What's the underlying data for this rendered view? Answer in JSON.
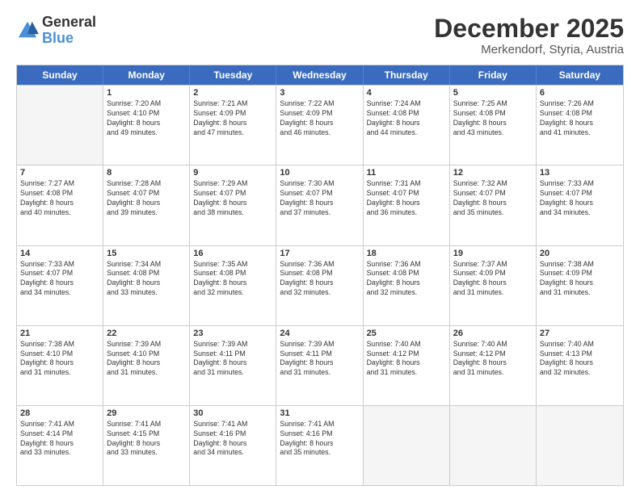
{
  "header": {
    "logo_general": "General",
    "logo_blue": "Blue",
    "month_title": "December 2025",
    "subtitle": "Merkendorf, Styria, Austria"
  },
  "calendar": {
    "days": [
      "Sunday",
      "Monday",
      "Tuesday",
      "Wednesday",
      "Thursday",
      "Friday",
      "Saturday"
    ],
    "rows": [
      [
        {
          "day": "",
          "text": ""
        },
        {
          "day": "1",
          "text": "Sunrise: 7:20 AM\nSunset: 4:10 PM\nDaylight: 8 hours\nand 49 minutes."
        },
        {
          "day": "2",
          "text": "Sunrise: 7:21 AM\nSunset: 4:09 PM\nDaylight: 8 hours\nand 47 minutes."
        },
        {
          "day": "3",
          "text": "Sunrise: 7:22 AM\nSunset: 4:09 PM\nDaylight: 8 hours\nand 46 minutes."
        },
        {
          "day": "4",
          "text": "Sunrise: 7:24 AM\nSunset: 4:08 PM\nDaylight: 8 hours\nand 44 minutes."
        },
        {
          "day": "5",
          "text": "Sunrise: 7:25 AM\nSunset: 4:08 PM\nDaylight: 8 hours\nand 43 minutes."
        },
        {
          "day": "6",
          "text": "Sunrise: 7:26 AM\nSunset: 4:08 PM\nDaylight: 8 hours\nand 41 minutes."
        }
      ],
      [
        {
          "day": "7",
          "text": "Sunrise: 7:27 AM\nSunset: 4:08 PM\nDaylight: 8 hours\nand 40 minutes."
        },
        {
          "day": "8",
          "text": "Sunrise: 7:28 AM\nSunset: 4:07 PM\nDaylight: 8 hours\nand 39 minutes."
        },
        {
          "day": "9",
          "text": "Sunrise: 7:29 AM\nSunset: 4:07 PM\nDaylight: 8 hours\nand 38 minutes."
        },
        {
          "day": "10",
          "text": "Sunrise: 7:30 AM\nSunset: 4:07 PM\nDaylight: 8 hours\nand 37 minutes."
        },
        {
          "day": "11",
          "text": "Sunrise: 7:31 AM\nSunset: 4:07 PM\nDaylight: 8 hours\nand 36 minutes."
        },
        {
          "day": "12",
          "text": "Sunrise: 7:32 AM\nSunset: 4:07 PM\nDaylight: 8 hours\nand 35 minutes."
        },
        {
          "day": "13",
          "text": "Sunrise: 7:33 AM\nSunset: 4:07 PM\nDaylight: 8 hours\nand 34 minutes."
        }
      ],
      [
        {
          "day": "14",
          "text": "Sunrise: 7:33 AM\nSunset: 4:07 PM\nDaylight: 8 hours\nand 34 minutes."
        },
        {
          "day": "15",
          "text": "Sunrise: 7:34 AM\nSunset: 4:08 PM\nDaylight: 8 hours\nand 33 minutes."
        },
        {
          "day": "16",
          "text": "Sunrise: 7:35 AM\nSunset: 4:08 PM\nDaylight: 8 hours\nand 32 minutes."
        },
        {
          "day": "17",
          "text": "Sunrise: 7:36 AM\nSunset: 4:08 PM\nDaylight: 8 hours\nand 32 minutes."
        },
        {
          "day": "18",
          "text": "Sunrise: 7:36 AM\nSunset: 4:08 PM\nDaylight: 8 hours\nand 32 minutes."
        },
        {
          "day": "19",
          "text": "Sunrise: 7:37 AM\nSunset: 4:09 PM\nDaylight: 8 hours\nand 31 minutes."
        },
        {
          "day": "20",
          "text": "Sunrise: 7:38 AM\nSunset: 4:09 PM\nDaylight: 8 hours\nand 31 minutes."
        }
      ],
      [
        {
          "day": "21",
          "text": "Sunrise: 7:38 AM\nSunset: 4:10 PM\nDaylight: 8 hours\nand 31 minutes."
        },
        {
          "day": "22",
          "text": "Sunrise: 7:39 AM\nSunset: 4:10 PM\nDaylight: 8 hours\nand 31 minutes."
        },
        {
          "day": "23",
          "text": "Sunrise: 7:39 AM\nSunset: 4:11 PM\nDaylight: 8 hours\nand 31 minutes."
        },
        {
          "day": "24",
          "text": "Sunrise: 7:39 AM\nSunset: 4:11 PM\nDaylight: 8 hours\nand 31 minutes."
        },
        {
          "day": "25",
          "text": "Sunrise: 7:40 AM\nSunset: 4:12 PM\nDaylight: 8 hours\nand 31 minutes."
        },
        {
          "day": "26",
          "text": "Sunrise: 7:40 AM\nSunset: 4:12 PM\nDaylight: 8 hours\nand 31 minutes."
        },
        {
          "day": "27",
          "text": "Sunrise: 7:40 AM\nSunset: 4:13 PM\nDaylight: 8 hours\nand 32 minutes."
        }
      ],
      [
        {
          "day": "28",
          "text": "Sunrise: 7:41 AM\nSunset: 4:14 PM\nDaylight: 8 hours\nand 33 minutes."
        },
        {
          "day": "29",
          "text": "Sunrise: 7:41 AM\nSunset: 4:15 PM\nDaylight: 8 hours\nand 33 minutes."
        },
        {
          "day": "30",
          "text": "Sunrise: 7:41 AM\nSunset: 4:16 PM\nDaylight: 8 hours\nand 34 minutes."
        },
        {
          "day": "31",
          "text": "Sunrise: 7:41 AM\nSunset: 4:16 PM\nDaylight: 8 hours\nand 35 minutes."
        },
        {
          "day": "",
          "text": ""
        },
        {
          "day": "",
          "text": ""
        },
        {
          "day": "",
          "text": ""
        }
      ]
    ]
  }
}
